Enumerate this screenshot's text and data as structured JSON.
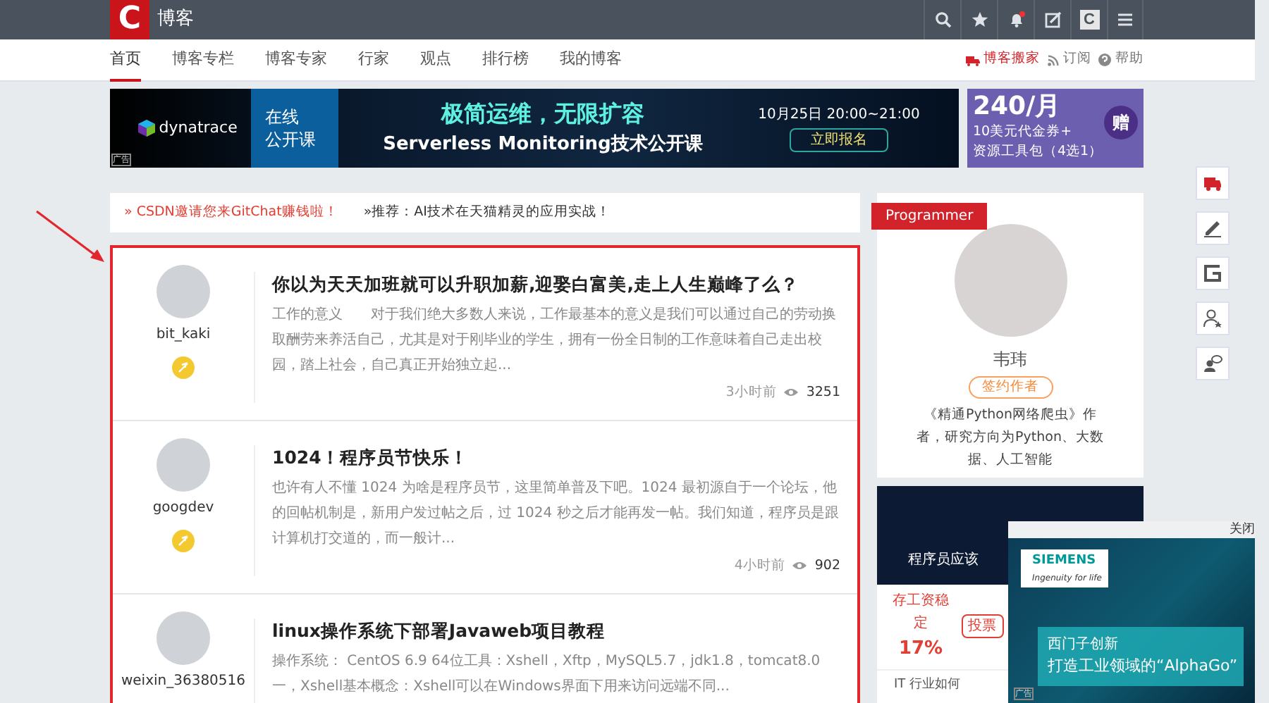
{
  "top_bar": {
    "logo": "C",
    "title": "博客",
    "logo_button": "C"
  },
  "nav": {
    "tabs": [
      {
        "label": "首页",
        "selected": true
      },
      {
        "label": "博客专栏",
        "selected": false
      },
      {
        "label": "博客专家",
        "selected": false
      },
      {
        "label": "行家",
        "selected": false
      },
      {
        "label": "观点",
        "selected": false
      },
      {
        "label": "排行榜",
        "selected": false
      },
      {
        "label": "我的博客",
        "selected": false
      }
    ],
    "links": [
      {
        "label": "博客搬家",
        "kind": "move"
      },
      {
        "label": "订阅",
        "kind": "rss"
      },
      {
        "label": "帮助",
        "kind": "help"
      }
    ]
  },
  "banner": {
    "brand": "dynatrace",
    "course_tag": "在线",
    "course_tag_2": "公开课",
    "headline": "极简运维，无限扩容",
    "subline": "Serverless Monitoring技术公开课",
    "date": "10月25日 20:00~21:00",
    "cta": "立即报名",
    "ad_label": "广告"
  },
  "side_ad": {
    "price": "240/月",
    "line1": "10美元代金券+",
    "line2": "资源工具包（4选1）",
    "badge": "赠"
  },
  "ticker": [
    {
      "text": "» CSDN邀请您来GitChat赚钱啦！",
      "color": "#e33e33"
    },
    {
      "text": "»推荐：AI技术在天猫精灵的应用实战！",
      "color": "#333333"
    }
  ],
  "articles": [
    {
      "author": "bit_kaki",
      "title": "你以为天天加班就可以升职加薪,迎娶白富美,走上人生巅峰了么？",
      "summary": "工作的意义　　对于我们绝大多数人来说，工作最基本的意义是我们可以通过自己的劳动换取酬劳来养活自己，尤其是对于刚毕业的学生，拥有一份全日制的工作意味着自己走出校园，踏上社会，自己真正开始独立起...",
      "time": "3小时前",
      "views": "3251"
    },
    {
      "author": "googdev",
      "title": "1024！程序员节快乐！",
      "summary": "也许有人不懂 1024 为啥是程序员节，这里简单普及下吧。1024 最初源自于一个论坛，他的回帖机制是，新用户发过帖之后，过 1024 秒之后才能再发一帖。我们知道，程序员是跟计算机打交道的，而一般计...",
      "time": "4小时前",
      "views": "902"
    },
    {
      "author": "weixin_36380516",
      "title": "linux操作系统下部署Javaweb项目教程",
      "summary": "操作系统： CentOS 6.9 64位工具：Xshell，Xftp，MySQL5.7，jdk1.8，tomcat8.0一，Xshell基本概念：Xshell可以在Windows界面下用来访问远端不同..."
    }
  ],
  "programmer_card": {
    "ribbon": "Programmer",
    "name": "韦玮",
    "tag": "签约作者",
    "description": "《精通Python网络爬虫》作者，研究方向为Python、大数据、人工智能"
  },
  "poll_card": {
    "heading": "程序员应该",
    "option": "存工资稳定",
    "percent": "17%",
    "button": "投票",
    "footer": "IT 行业如何"
  },
  "float_ad": {
    "close": "关闭",
    "brand": "SIEMENS",
    "slogan": "Ingenuity for life",
    "line1": "西门子创新",
    "line2": "打造工业领域的“AlphaGo”",
    "ad_label": "广告"
  }
}
